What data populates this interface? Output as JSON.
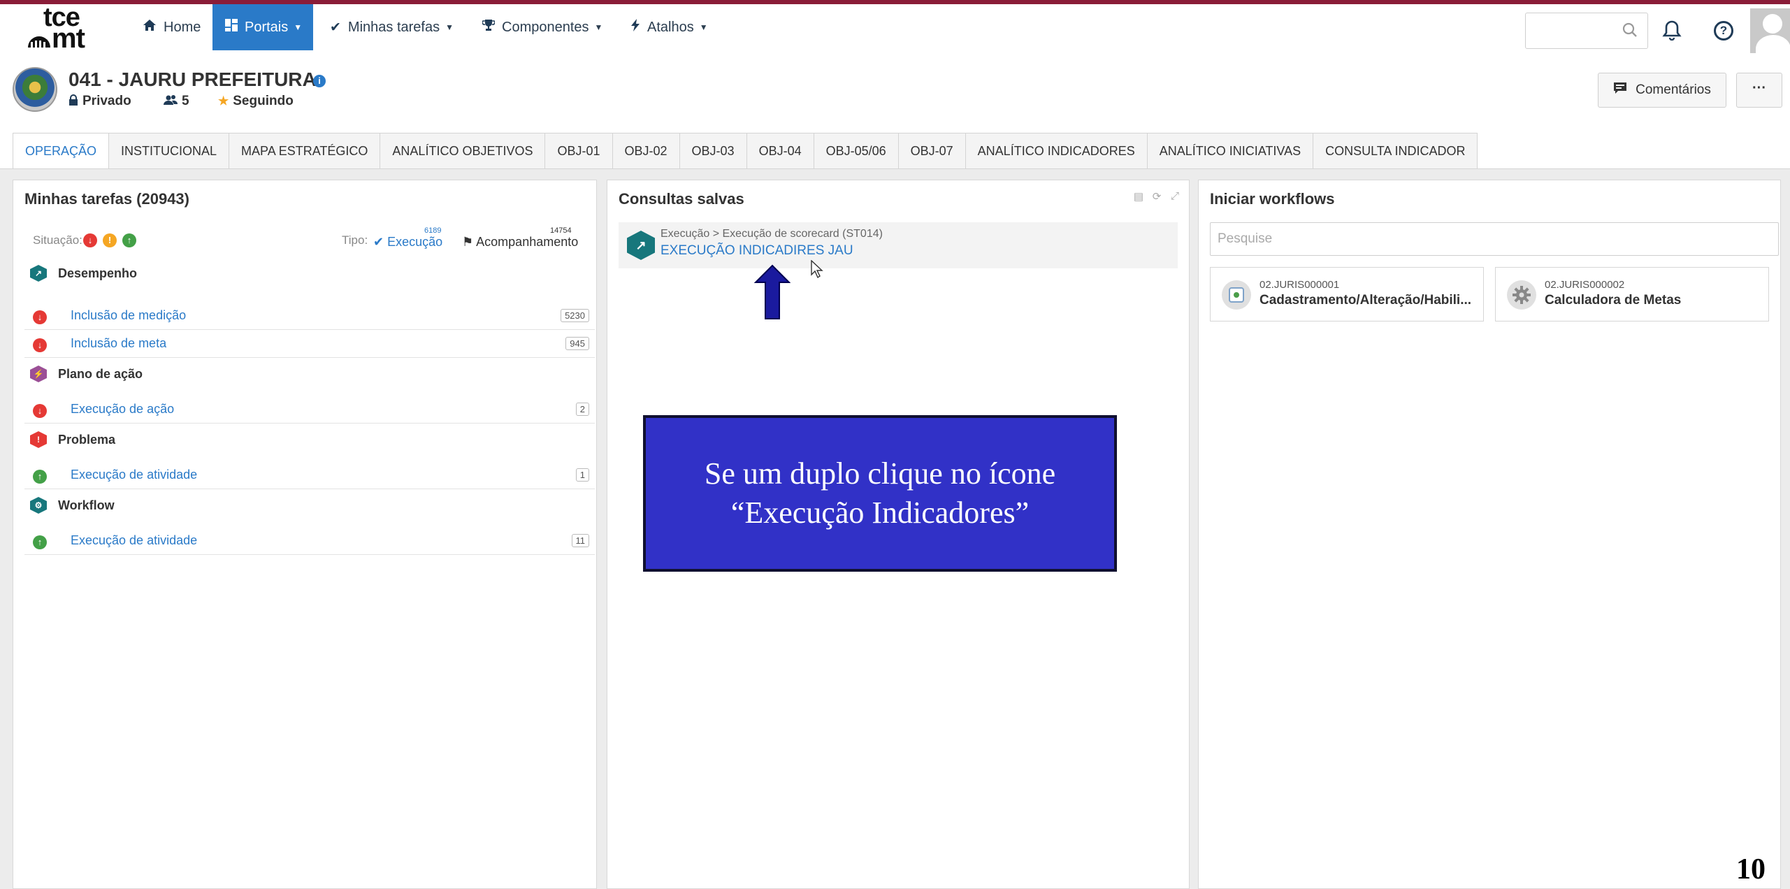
{
  "brand": {
    "line1": "tce",
    "line2": "mt"
  },
  "nav": {
    "home": "Home",
    "portais": "Portais",
    "minhas_tarefas": "Minhas tarefas",
    "componentes": "Componentes",
    "atalhos": "Atalhos"
  },
  "header": {
    "title": "041 - JAURU PREFEITURA",
    "privacy": "Privado",
    "members": "5",
    "follow": "Seguindo",
    "comments_button": "Comentários",
    "more_button": "···"
  },
  "tabs": [
    {
      "label": "OPERAÇÃO",
      "active": true
    },
    {
      "label": "INSTITUCIONAL"
    },
    {
      "label": "MAPA ESTRATÉGICO"
    },
    {
      "label": "ANALÍTICO OBJETIVOS"
    },
    {
      "label": "OBJ-01"
    },
    {
      "label": "OBJ-02"
    },
    {
      "label": "OBJ-03"
    },
    {
      "label": "OBJ-04"
    },
    {
      "label": "OBJ-05/06"
    },
    {
      "label": "OBJ-07"
    },
    {
      "label": "ANALÍTICO INDICADORES"
    },
    {
      "label": "ANALÍTICO INICIATIVAS"
    },
    {
      "label": "CONSULTA INDICADOR"
    }
  ],
  "tasks": {
    "title": "Minhas tarefas (20943)",
    "situacao_label": "Situação:",
    "tipo_label": "Tipo:",
    "tipo_execucao": "Execução",
    "tipo_execucao_count": "6189",
    "tipo_acompanhamento": "Acompanhamento",
    "tipo_acompanhamento_count": "14754",
    "groups": [
      {
        "name": "Desempenho",
        "tasks": [
          {
            "label": "Inclusão de medição",
            "count": "5230",
            "status": "red"
          },
          {
            "label": "Inclusão de meta",
            "count": "945",
            "status": "red"
          }
        ]
      },
      {
        "name": "Plano de ação",
        "tasks": [
          {
            "label": "Execução de ação",
            "count": "2",
            "status": "red"
          }
        ]
      },
      {
        "name": "Problema",
        "tasks": [
          {
            "label": "Execução de atividade",
            "count": "1",
            "status": "green"
          }
        ]
      },
      {
        "name": "Workflow",
        "tasks": [
          {
            "label": "Execução de atividade",
            "count": "11",
            "status": "green"
          }
        ]
      }
    ]
  },
  "saved_queries": {
    "title": "Consultas salvas",
    "item": {
      "path": "Execução > Execução de scorecard (ST014)",
      "name": "EXECUÇÃO INDICADIRES JAU"
    }
  },
  "callout": {
    "line1": "Se um duplo clique no ícone",
    "line2": "“Execução Indicadores”"
  },
  "workflows": {
    "title": "Iniciar workflows",
    "search_placeholder": "Pesquise",
    "items": [
      {
        "code": "02.JURIS000001",
        "name": "Cadastramento/Alteração/Habili..."
      },
      {
        "code": "02.JURIS000002",
        "name": "Calculadora de Metas"
      }
    ]
  },
  "page_number": "10",
  "colors": {
    "accent": "#2a7ac8",
    "top_stripe": "#8a1c38",
    "callout_bg": "#3131c7",
    "arrow": "#1a1a9e"
  }
}
